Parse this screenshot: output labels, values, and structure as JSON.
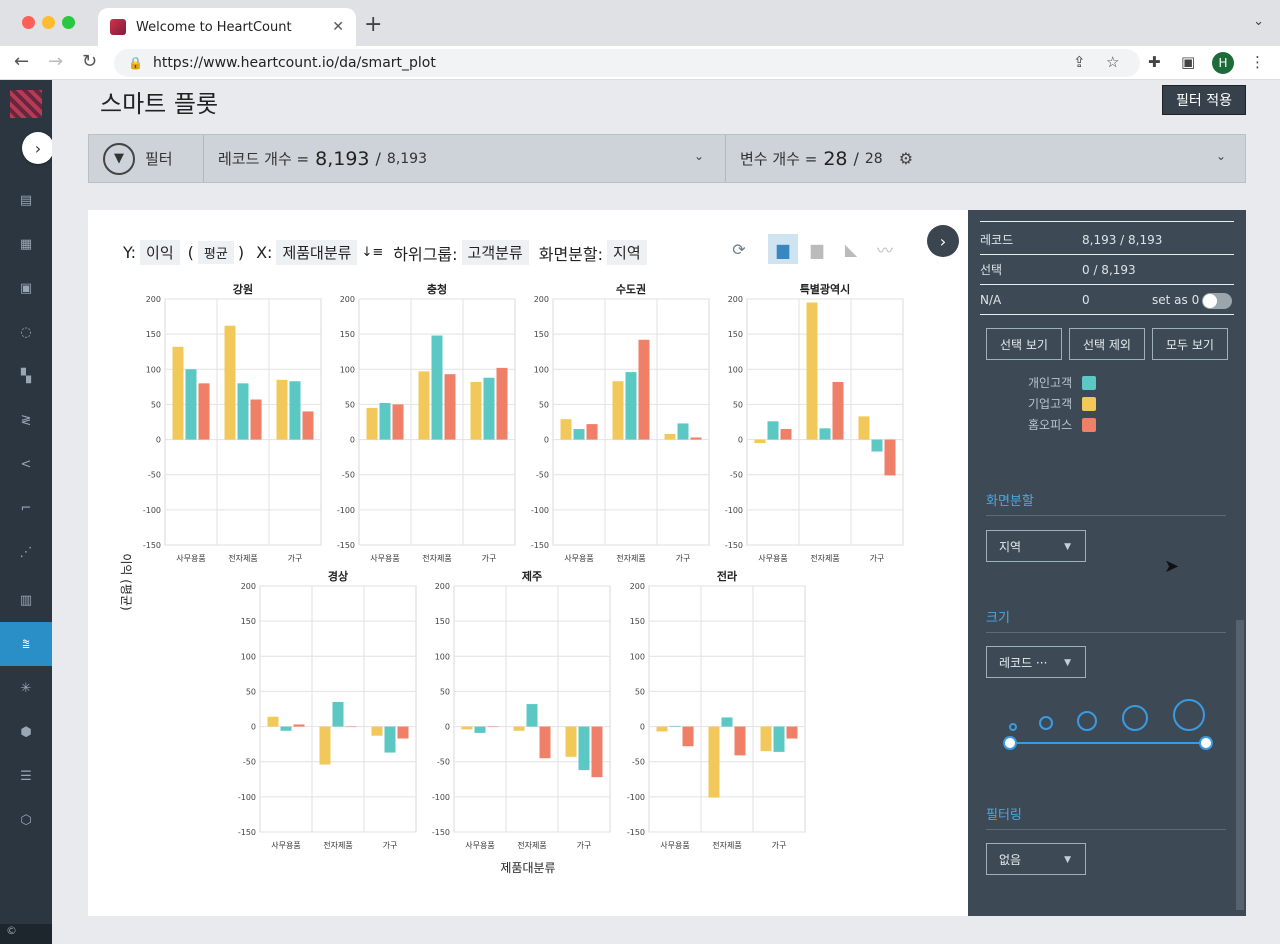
{
  "browser": {
    "tab_title": "Welcome to HeartCount",
    "url": "https://www.heartcount.io/da/smart_plot",
    "avatar_letter": "H"
  },
  "page": {
    "title": "스마트 플롯",
    "apply_filter": "필터 적용"
  },
  "filterbar": {
    "label": "필터",
    "record_label": "레코드 개수 =",
    "record_value": "8,193",
    "record_sep": "/",
    "record_total": "8,193",
    "var_label": "변수 개수 =",
    "var_value": "28",
    "var_sep": "/",
    "var_total": "28"
  },
  "controls": {
    "y_label": "Y:",
    "y_value": "이익",
    "agg_open": "(",
    "agg_value": "평균",
    "agg_close": ")",
    "x_label": "X:",
    "x_value": "제품대분류",
    "sub_label": "하위그룹:",
    "sub_value": "고객분류",
    "split_label": "화면분할:",
    "split_value": "지역"
  },
  "right_panel": {
    "record_label": "레코드",
    "record_value": "8,193 / 8,193",
    "select_label": "선택",
    "select_value": "0 / 8,193",
    "na_label": "N/A",
    "na_value": "0",
    "set_zero_label": "set as 0",
    "buttons": [
      "선택 보기",
      "선택 제외",
      "모두 보기"
    ],
    "legend": [
      {
        "name": "개인고객",
        "color": "#5bc8c4"
      },
      {
        "name": "기업고객",
        "color": "#f2c85b"
      },
      {
        "name": "홈오피스",
        "color": "#ef7f67"
      }
    ],
    "split_section": "화면분할",
    "split_value": "지역",
    "size_section": "크기",
    "size_value": "레코드 ···",
    "filtering_section": "필터링",
    "filtering_value": "없음"
  },
  "chart_data": {
    "type": "bar",
    "ylabel": "이익 (평균)",
    "xlabel": "제품대분류",
    "ylim": [
      -150,
      200
    ],
    "yticks": [
      200,
      150,
      100,
      50,
      0,
      -50,
      -100,
      -150
    ],
    "categories": [
      "사무용품",
      "전자제품",
      "가구"
    ],
    "series_names": [
      "기업고객",
      "개인고객",
      "홈오피스"
    ],
    "colors": [
      "#f2c85b",
      "#5bc8c4",
      "#ef7f67"
    ],
    "grid": true,
    "panels": [
      {
        "title": "강원",
        "values": [
          [
            132,
            100,
            80
          ],
          [
            162,
            80,
            57
          ],
          [
            85,
            83,
            40
          ]
        ]
      },
      {
        "title": "충청",
        "values": [
          [
            45,
            52,
            50
          ],
          [
            97,
            148,
            93
          ],
          [
            82,
            88,
            102
          ]
        ]
      },
      {
        "title": "수도권",
        "values": [
          [
            29,
            15,
            22
          ],
          [
            83,
            96,
            142
          ],
          [
            8,
            23,
            3
          ]
        ]
      },
      {
        "title": "특별광역시",
        "values": [
          [
            -5,
            26,
            15
          ],
          [
            195,
            16,
            82
          ],
          [
            33,
            -17,
            -51
          ]
        ]
      },
      {
        "title": "경상",
        "values": [
          [
            14,
            -6,
            3
          ],
          [
            -54,
            35,
            0
          ],
          [
            -13,
            -37,
            -17
          ]
        ]
      },
      {
        "title": "제주",
        "values": [
          [
            -4,
            -9,
            0
          ],
          [
            -6,
            32,
            -45
          ],
          [
            -43,
            -62,
            -72
          ]
        ]
      },
      {
        "title": "전라",
        "values": [
          [
            -7,
            1,
            -28
          ],
          [
            -101,
            13,
            -41
          ],
          [
            -35,
            -36,
            -17
          ]
        ]
      }
    ]
  }
}
